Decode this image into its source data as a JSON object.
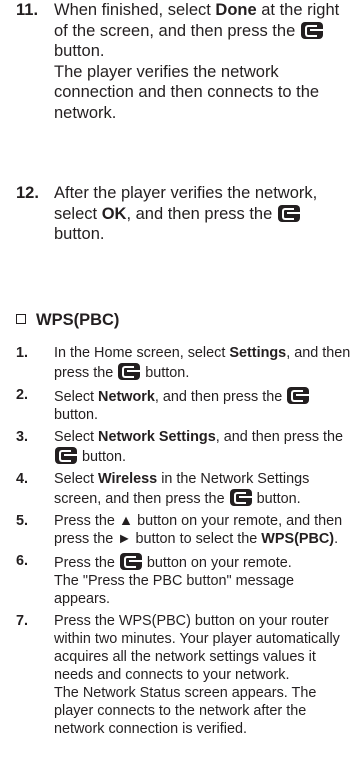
{
  "steps_top": [
    {
      "num": "11.",
      "pre": "When finished, select ",
      "bold": "Done",
      "post": " at the right of the screen, and then press the ",
      "post2": " button.",
      "note": "The player verifies the network connection and then connects to the network."
    },
    {
      "num": "12.",
      "pre": "After the player verifies the network, select ",
      "bold": "OK",
      "post": ", and then press the ",
      "post2": " button."
    }
  ],
  "section_title": "WPS(PBC)",
  "steps": [
    {
      "num": "1.",
      "pre": "In the Home screen, select ",
      "bold": "Settings",
      "post": ", and then press the ",
      "post2": " button."
    },
    {
      "num": "2.",
      "pre": "Select ",
      "bold": "Network",
      "post": ", and then press the ",
      "post2": " button."
    },
    {
      "num": "3.",
      "pre": "Select ",
      "bold": "Network Settings",
      "post": ", and then press the ",
      "post2": " button."
    },
    {
      "num": "4.",
      "pre": "Select ",
      "bold": "Wireless",
      "post": " in the Network Settings screen, and then press the ",
      "post2": " button."
    },
    {
      "num": "5.",
      "pre": "Press the ▲ button on your remote, and then press the ► button to select the ",
      "bold": "WPS(PBC)",
      "post": "."
    },
    {
      "num": "6.",
      "pre": "Press the ",
      "post2": " button on your remote.",
      "note": "The \"Press the PBC button\" message appears."
    },
    {
      "num": "7.",
      "pre": "Press the WPS(PBC) button on your router within two minutes. Your player automatically acquires all the network settings values it needs and connects to your network.",
      "note": "The Network Status screen appears. The player connects to the network after the network connection is verified."
    }
  ],
  "icon_name": "enter-button-icon"
}
